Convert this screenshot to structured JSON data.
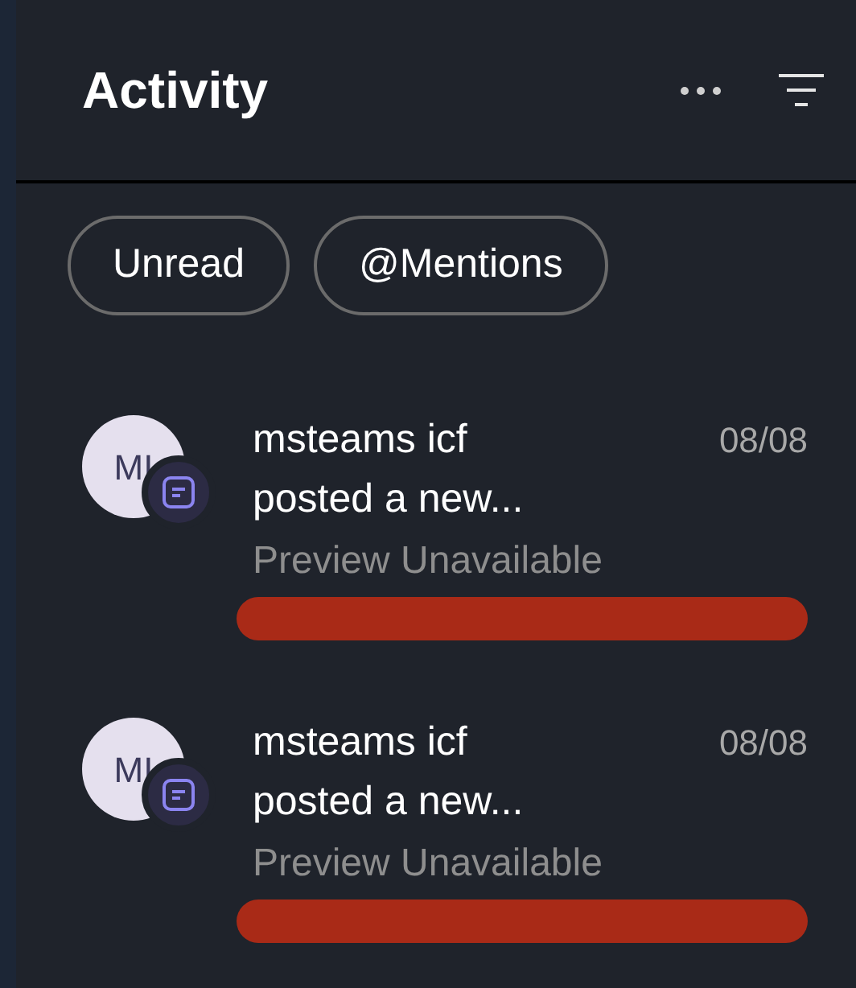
{
  "header": {
    "title": "Activity"
  },
  "filters": [
    {
      "label": "Unread"
    },
    {
      "label": "@Mentions"
    }
  ],
  "items": [
    {
      "initials": "MI",
      "name": "msteams icf",
      "date": "08/08",
      "action": "posted a new...",
      "preview": "Preview Unavailable"
    },
    {
      "initials": "MI",
      "name": "msteams icf",
      "date": "08/08",
      "action": "posted a new...",
      "preview": "Preview Unavailable"
    }
  ]
}
